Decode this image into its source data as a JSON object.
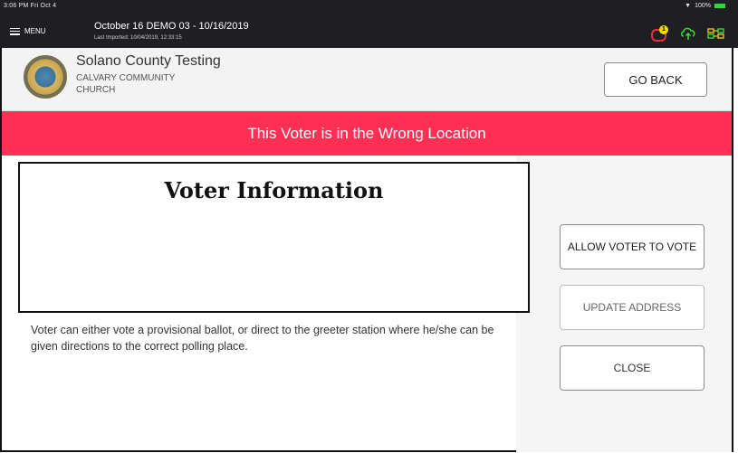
{
  "status_bar": {
    "time": "3:06 PM",
    "date": "Fri Oct 4",
    "signal": "▼",
    "battery_text": "100%"
  },
  "app_bar": {
    "menu_label": "MENU",
    "election_title": "October 16 DEMO 03 - 10/16/2019",
    "last_import": "Last Imported: 10/04/2019, 12:33:15",
    "alert_count": "1"
  },
  "header": {
    "county": "Solano County Testing",
    "location_line1": "CALVARY COMMUNITY",
    "location_line2": "CHURCH",
    "go_back_label": "GO BACK"
  },
  "banner": {
    "text": "This Voter is in the Wrong Location"
  },
  "voter_info": {
    "title": "Voter Information"
  },
  "message": "Voter can either vote a provisional ballot, or direct to the greeter station where he/she can be given directions to the correct polling place.",
  "actions": {
    "allow_label": "ALLOW VOTER TO VOTE",
    "update_label": "UPDATE ADDRESS",
    "close_label": "CLOSE"
  },
  "colors": {
    "banner": "#ff2f55",
    "top_bar": "#1f1f23",
    "alert": "#ef2d3e",
    "badge": "#f7d900",
    "ok_green": "#3bd13b"
  }
}
